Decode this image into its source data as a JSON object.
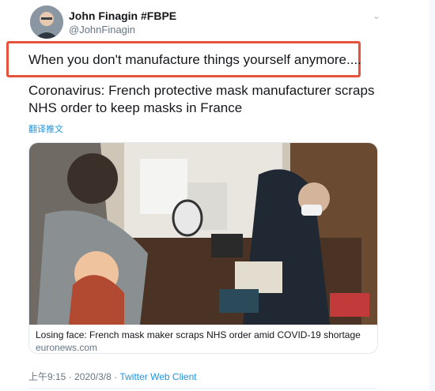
{
  "tweet": {
    "author_name": "John Finagin #FBPE",
    "author_handle": "@JohnFinagin",
    "text": "When you don't manufacture things yourself anymore....",
    "headline": "Coronavirus: French protective mask manufacturer scraps NHS order to keep masks in France",
    "translate_label": "翻译推文",
    "card": {
      "title": "Losing face: French mask maker scraps NHS order amid COVID-19 shortage",
      "domain": "euronews.com"
    },
    "time": "上午9:15",
    "separator": "·",
    "date": "2020/3/8",
    "client": "Twitter Web Client"
  },
  "colors": {
    "accent": "#1b95e0",
    "highlight_box": "#e5533c",
    "muted": "#657786"
  },
  "icons": {
    "more": "chevron-down-icon"
  }
}
